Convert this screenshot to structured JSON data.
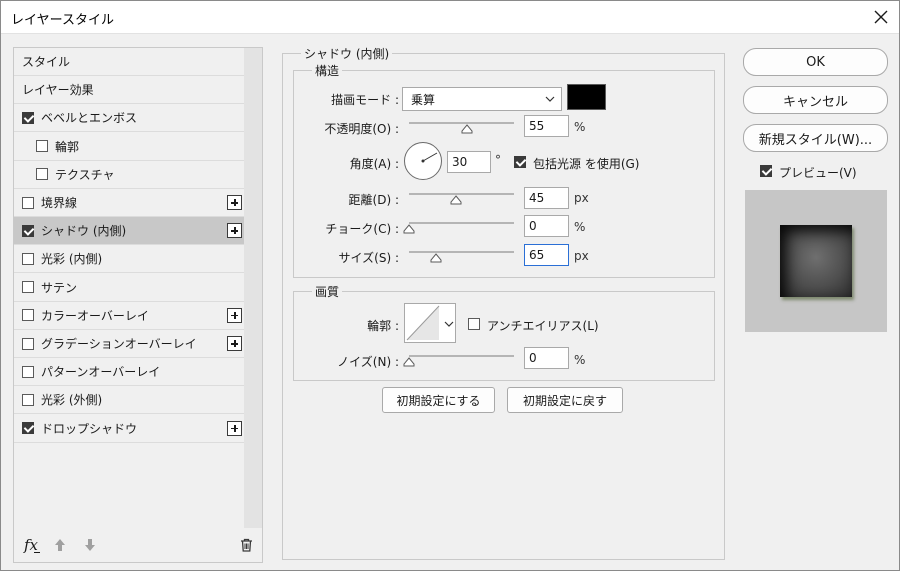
{
  "window": {
    "title": "レイヤースタイル"
  },
  "style_list": {
    "items": [
      {
        "label": "スタイル",
        "checkbox": false,
        "checked": false,
        "indent": false,
        "plus": false,
        "selected": false
      },
      {
        "label": "レイヤー効果",
        "checkbox": false,
        "checked": false,
        "indent": false,
        "plus": false,
        "selected": false
      },
      {
        "label": "ベベルとエンボス",
        "checkbox": true,
        "checked": true,
        "indent": false,
        "plus": false,
        "selected": false
      },
      {
        "label": "輪郭",
        "checkbox": true,
        "checked": false,
        "indent": true,
        "plus": false,
        "selected": false
      },
      {
        "label": "テクスチャ",
        "checkbox": true,
        "checked": false,
        "indent": true,
        "plus": false,
        "selected": false
      },
      {
        "label": "境界線",
        "checkbox": true,
        "checked": false,
        "indent": false,
        "plus": true,
        "selected": false
      },
      {
        "label": "シャドウ (内側)",
        "checkbox": true,
        "checked": true,
        "indent": false,
        "plus": true,
        "selected": true
      },
      {
        "label": "光彩 (内側)",
        "checkbox": true,
        "checked": false,
        "indent": false,
        "plus": false,
        "selected": false
      },
      {
        "label": "サテン",
        "checkbox": true,
        "checked": false,
        "indent": false,
        "plus": false,
        "selected": false
      },
      {
        "label": "カラーオーバーレイ",
        "checkbox": true,
        "checked": false,
        "indent": false,
        "plus": true,
        "selected": false
      },
      {
        "label": "グラデーションオーバーレイ",
        "checkbox": true,
        "checked": false,
        "indent": false,
        "plus": true,
        "selected": false
      },
      {
        "label": "パターンオーバーレイ",
        "checkbox": true,
        "checked": false,
        "indent": false,
        "plus": false,
        "selected": false
      },
      {
        "label": "光彩 (外側)",
        "checkbox": true,
        "checked": false,
        "indent": false,
        "plus": false,
        "selected": false
      },
      {
        "label": "ドロップシャドウ",
        "checkbox": true,
        "checked": true,
        "indent": false,
        "plus": true,
        "selected": false
      }
    ],
    "footer": {
      "fx_label": "fx"
    }
  },
  "panel": {
    "title": "シャドウ (内側)",
    "structure": {
      "title": "構造",
      "blend_mode_label": "描画モード :",
      "blend_mode_value": "乗算",
      "color": "#000000",
      "opacity_label": "不透明度(O) :",
      "opacity_value": "55",
      "opacity_unit": "%",
      "opacity_level": 0.55,
      "angle_label": "角度(A) :",
      "angle_value": "30",
      "angle_unit": "°",
      "global_light_label": "包括光源 を使用(G)",
      "global_light_checked": true,
      "distance_label": "距離(D) :",
      "distance_value": "45",
      "distance_unit": "px",
      "distance_level": 0.45,
      "choke_label": "チョーク(C) :",
      "choke_value": "0",
      "choke_unit": "%",
      "choke_level": 0.0,
      "size_label": "サイズ(S) :",
      "size_value": "65",
      "size_unit": "px",
      "size_level": 0.26
    },
    "quality": {
      "title": "画質",
      "contour_label": "輪郭 :",
      "antialias_label": "アンチエイリアス(L)",
      "antialias_checked": false,
      "noise_label": "ノイズ(N) :",
      "noise_value": "0",
      "noise_unit": "%",
      "noise_level": 0.0
    },
    "buttons": {
      "make_default": "初期設定にする",
      "reset_default": "初期設定に戻す"
    }
  },
  "right": {
    "ok": "OK",
    "cancel": "キャンセル",
    "new_style": "新規スタイル(W)...",
    "preview_label": "プレビュー(V)",
    "preview_checked": true
  }
}
